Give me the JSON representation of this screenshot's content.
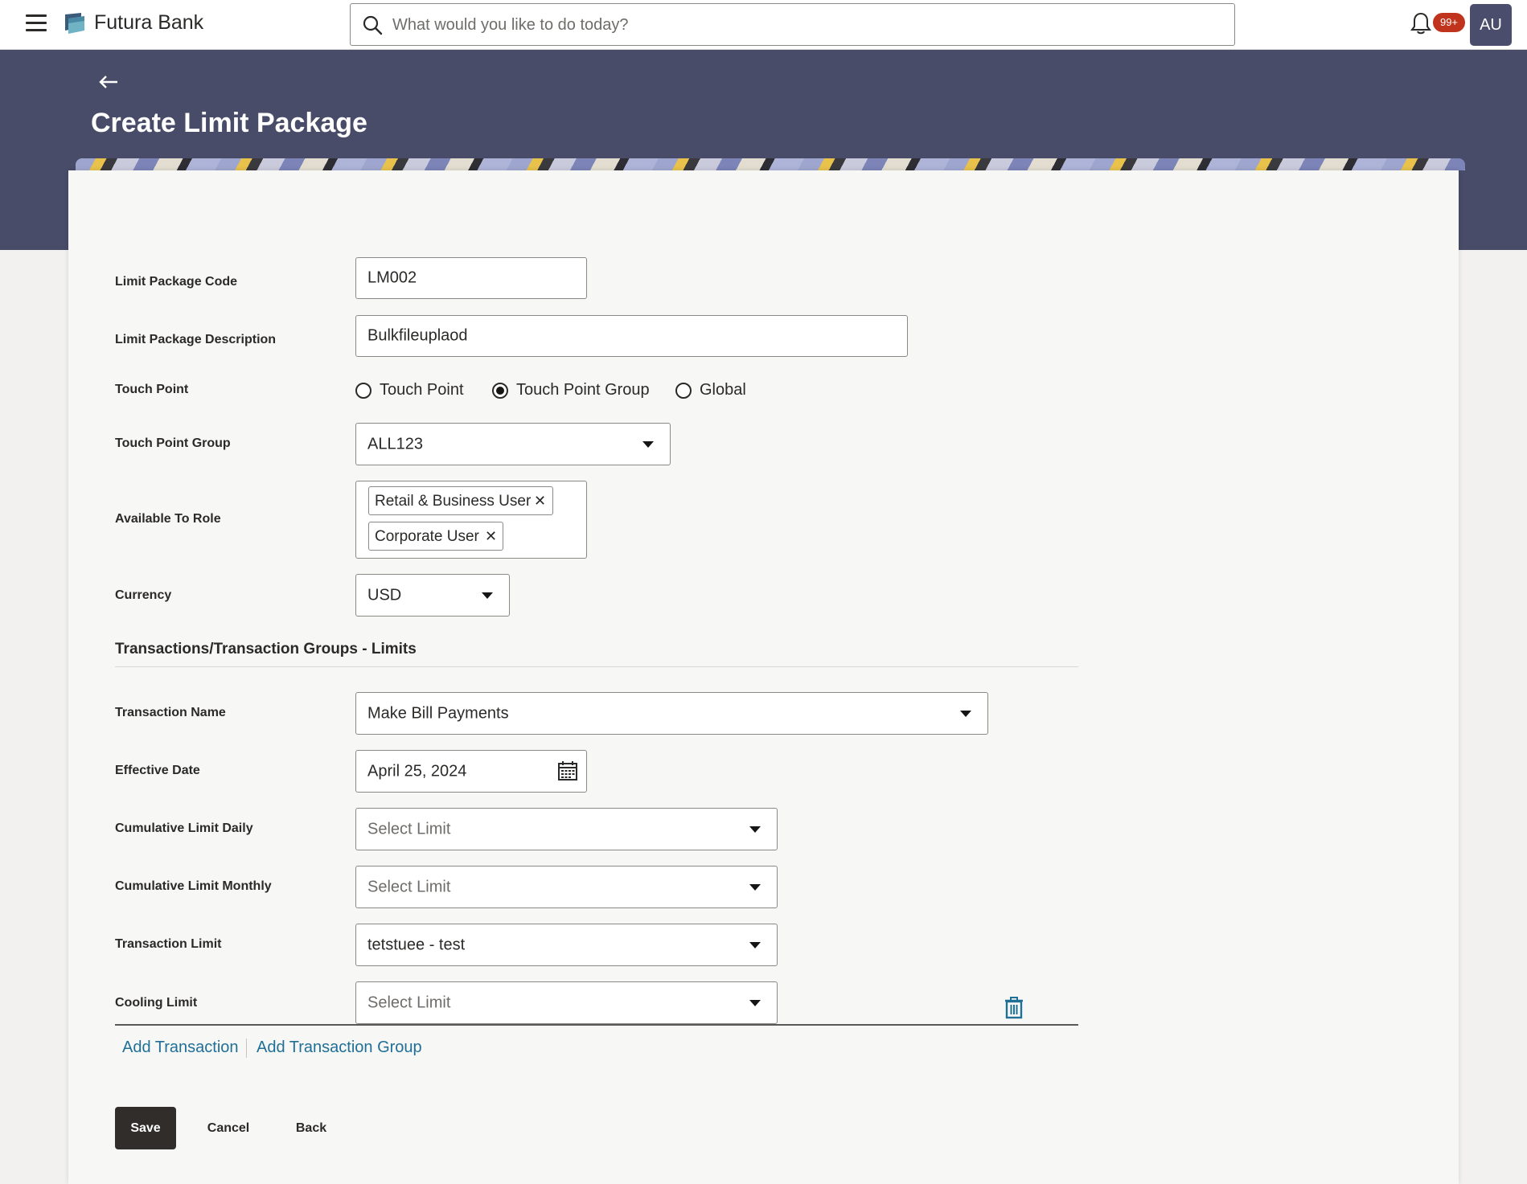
{
  "header": {
    "brand": "Futura Bank",
    "search_placeholder": "What would you like to do today?",
    "notification_count": "99+",
    "avatar_initials": "AU"
  },
  "page": {
    "title": "Create Limit Package"
  },
  "form": {
    "limit_package_code": {
      "label": "Limit Package Code",
      "value": "LM002"
    },
    "limit_package_description": {
      "label": "Limit Package Description",
      "value": "Bulkfileuplaod"
    },
    "touch_point": {
      "label": "Touch Point",
      "options": [
        "Touch Point",
        "Touch Point Group",
        "Global"
      ],
      "selected": "Touch Point Group"
    },
    "touch_point_group": {
      "label": "Touch Point Group",
      "value": "ALL123"
    },
    "available_to_role": {
      "label": "Available To Role",
      "chips": [
        "Retail & Business User",
        "Corporate User"
      ]
    },
    "currency": {
      "label": "Currency",
      "value": "USD"
    }
  },
  "limits_section": {
    "title": "Transactions/Transaction Groups - Limits",
    "transaction_name": {
      "label": "Transaction Name",
      "value": "Make Bill Payments"
    },
    "effective_date": {
      "label": "Effective Date",
      "value": "April 25, 2024"
    },
    "cumulative_limit_daily": {
      "label": "Cumulative Limit Daily",
      "placeholder": "Select Limit"
    },
    "cumulative_limit_monthly": {
      "label": "Cumulative Limit Monthly",
      "placeholder": "Select Limit"
    },
    "transaction_limit": {
      "label": "Transaction Limit",
      "value": "tetstuee - test"
    },
    "cooling_limit": {
      "label": "Cooling Limit",
      "placeholder": "Select Limit"
    }
  },
  "links": {
    "add_transaction": "Add Transaction",
    "add_transaction_group": "Add Transaction Group"
  },
  "actions": {
    "save": "Save",
    "cancel": "Cancel",
    "back": "Back"
  },
  "colors": {
    "banner": "#484c69",
    "primary_button": "#312d2a",
    "link": "#1f6f96",
    "badge": "#c0341d"
  }
}
